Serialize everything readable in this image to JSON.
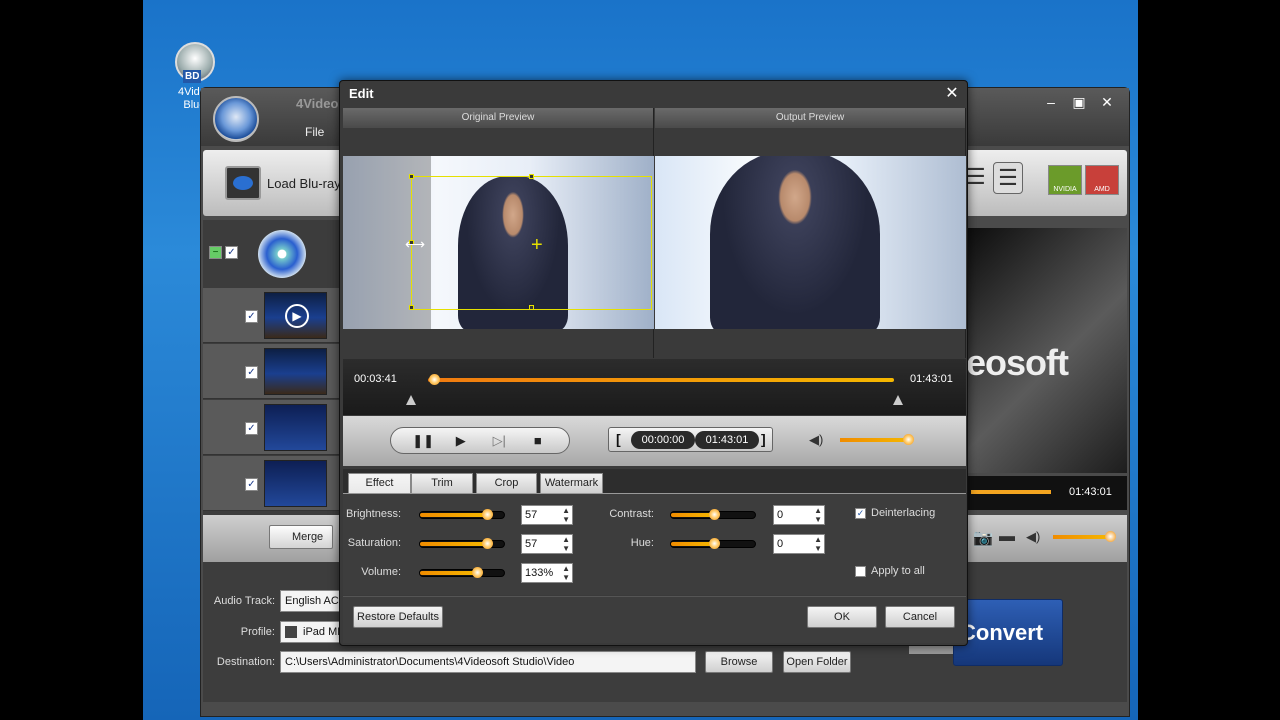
{
  "desktop_icon": {
    "label": "4Video Blu-r",
    "badge": "BD"
  },
  "main_window": {
    "title": "4Video",
    "menu": {
      "file": "File"
    },
    "toolbar": {
      "load_bluray": "Load Blu-ray"
    },
    "gpu": {
      "nvidia": "NVIDIA",
      "amd": "AMD"
    },
    "list_rows": 4,
    "merge": "Merge",
    "brand_text": "eosoft",
    "background_end_time": "01:43:01",
    "settings": {
      "audio_track_label": "Audio Track:",
      "audio_track_value": "English AC3",
      "profile_label": "Profile:",
      "profile_value": "iPad MP",
      "destination_label": "Destination:",
      "destination_value": "C:\\Users\\Administrator\\Documents\\4Videosoft Studio\\Video",
      "browse": "Browse",
      "open_folder": "Open Folder",
      "convert": "Convert"
    }
  },
  "edit_dialog": {
    "title": "Edit",
    "original_preview": "Original Preview",
    "output_preview": "Output Preview",
    "timeline": {
      "current": "00:03:41",
      "end": "01:43:01",
      "progress": 0.0
    },
    "controls": {
      "start_time": "00:00:00",
      "end_time": "01:43:01",
      "volume_level": 0.95
    },
    "tabs": [
      "Effect",
      "Trim",
      "Crop",
      "Watermark"
    ],
    "active_tab": "Effect",
    "effect": {
      "brightness_label": "Brightness:",
      "brightness_value": "57",
      "saturation_label": "Saturation:",
      "saturation_value": "57",
      "volume_label": "Volume:",
      "volume_value": "133%",
      "contrast_label": "Contrast:",
      "contrast_value": "0",
      "hue_label": "Hue:",
      "hue_value": "0",
      "deinterlacing": "Deinterlacing",
      "deinterlacing_checked": true,
      "apply_to_all": "Apply to all",
      "apply_to_all_checked": false
    },
    "footer": {
      "restore_defaults": "Restore Defaults",
      "ok": "OK",
      "cancel": "Cancel"
    }
  },
  "colors": {
    "accent": "#f5a000",
    "crop_box": "#e5e000",
    "convert_blue": "#2e5fb5"
  }
}
